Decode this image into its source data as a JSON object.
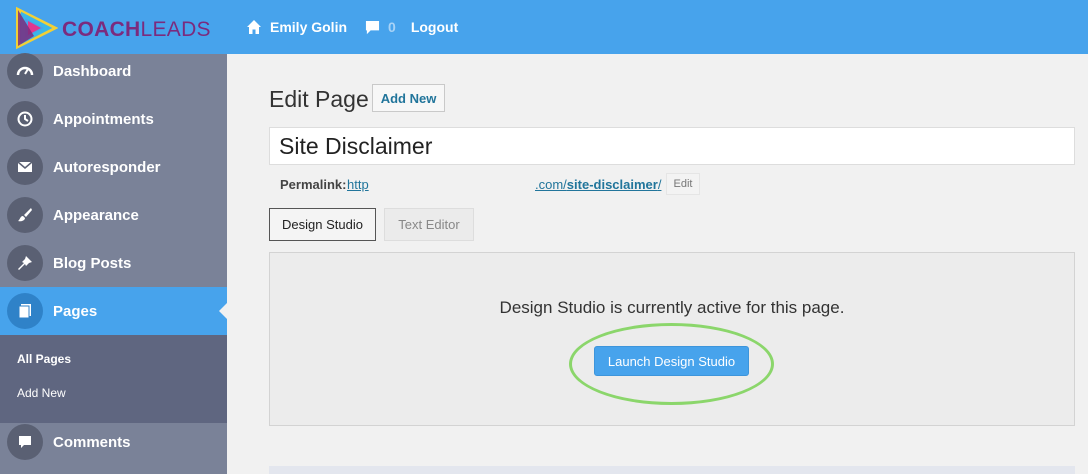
{
  "brand": {
    "name_part1": "COACH",
    "name_part2": "LEADS"
  },
  "topnav": {
    "user_name": "Emily Golin",
    "comment_count": "0",
    "logout_label": "Logout"
  },
  "sidebar": {
    "items": [
      {
        "label": "Dashboard",
        "icon": "dashboard-icon"
      },
      {
        "label": "Appointments",
        "icon": "history-icon"
      },
      {
        "label": "Autoresponder",
        "icon": "envelope-icon"
      },
      {
        "label": "Appearance",
        "icon": "brush-icon"
      },
      {
        "label": "Blog Posts",
        "icon": "pin-icon"
      },
      {
        "label": "Pages",
        "icon": "pages-icon"
      },
      {
        "label": "Comments",
        "icon": "comment-icon"
      }
    ],
    "submenu": [
      {
        "label": "All Pages"
      },
      {
        "label": "Add New"
      }
    ]
  },
  "main": {
    "page_title": "Edit Page",
    "add_new_label": "Add New",
    "title_value": "Site Disclaimer",
    "permalink": {
      "label": "Permalink:",
      "url_start": "http",
      "url_middle": ".com/",
      "url_slug": "site-disclaimer",
      "url_end": "/",
      "edit_label": "Edit"
    },
    "tabs": [
      {
        "label": "Design Studio",
        "active": true
      },
      {
        "label": "Text Editor",
        "active": false
      }
    ],
    "panel_message": "Design Studio is currently active for this page.",
    "launch_label": "Launch Design Studio"
  },
  "colors": {
    "topbar": "#47a3ec",
    "sidebar": "#7a8298",
    "submenu": "#5f6680",
    "highlight": "#8bd66b"
  }
}
